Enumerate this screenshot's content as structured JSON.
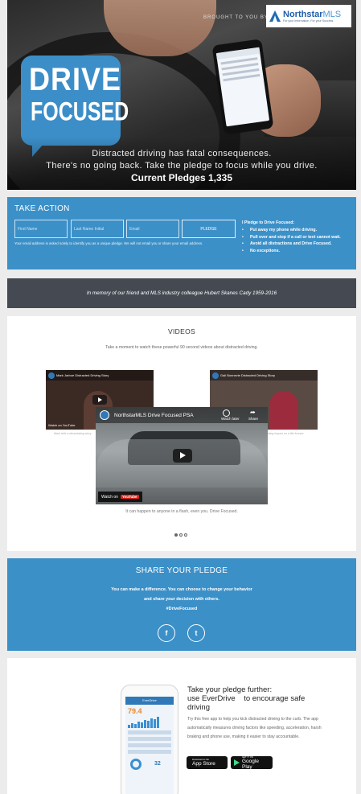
{
  "hero": {
    "brought_by": "BROUGHT TO YOU BY:",
    "brand_name": "Northstar",
    "brand_suffix": "MLS",
    "brand_tagline": "For your Information. For your Success.",
    "logo_line1": "DRIVE",
    "logo_line2": "FOCUSED",
    "headline1": "Distracted driving has fatal consequences.",
    "headline2": "There's no going back. Take the pledge to focus while you drive.",
    "pledges": "Current Pledges 1,335"
  },
  "take_action": {
    "title": "TAKE ACTION",
    "first_name_placeholder": "First Name",
    "last_name_placeholder": "Last Name Initial",
    "email_placeholder": "Email",
    "pledge_button": "PLEDGE",
    "note": "Your email address is asked solely to identify you as a unique pledge. We will not email you or share your email address.",
    "pledge_heading": "I Pledge to Drive Focused:",
    "pledge_items": [
      "Put away my phone while driving.",
      "Pull over and stop if a call or text cannot wait.",
      "Avoid all distractions and Drive Focused.",
      "No exceptions."
    ]
  },
  "memorial": {
    "text": "In memory of our friend and MLS industry colleague Hubert Skanes Cady 1959-2016"
  },
  "videos": {
    "title": "VIDEOS",
    "subtitle": "Take a moment to watch these powerful 90 second videos about distracted driving.",
    "left_video_title": "Mark Jarboe Distracted Driving Story",
    "right_video_title": "Gail Bonnevie Distracted Driving Story",
    "left_caption": "Mark tells a devastating story",
    "right_caption": "a lasting impact on a life forever",
    "main_video_title": "NorthstarMLS Drive Focused PSA",
    "watch_later": "Watch later",
    "share": "Share",
    "watch_on": "Watch on",
    "youtube": "YouTube",
    "tagline": "It can happen to anyone in a flash, even you. Drive Focused."
  },
  "share": {
    "title": "SHARE YOUR PLEDGE",
    "line1": "You can make a difference. You can choose to change your behavior",
    "line2": "and share your decision with others.",
    "hashtag": "#DriveFocused",
    "facebook_glyph": "f",
    "twitter_glyph": "t"
  },
  "app": {
    "heading_line1": "Take your pledge further:",
    "heading_line2": "use EverDrive    to encourage safe",
    "heading_line3": "driving",
    "body": "Try this free app to help you kick distracted driving to the curb. The app automatically measures driving factors like speeding, acceleration, harsh braking and phone use, making it easier to stay accountable.",
    "phone_app_name": "EverDrive",
    "phone_score": "79.4",
    "phone_number": "32",
    "app_store_small": "Download on the",
    "app_store_big": "App Store",
    "google_small": "GET IT ON",
    "google_big": "Google Play"
  }
}
